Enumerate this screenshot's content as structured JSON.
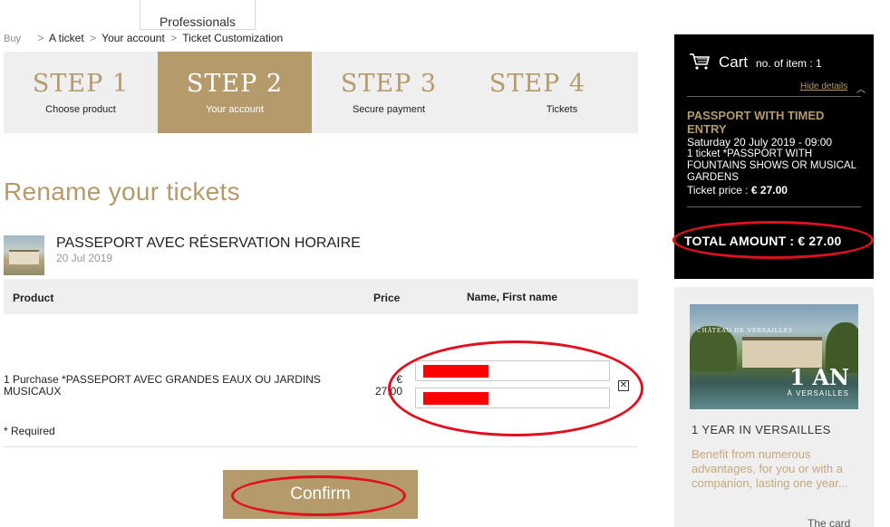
{
  "header": {
    "professionals_tab": "Professionals"
  },
  "breadcrumb": {
    "items": [
      "Buy",
      "A ticket",
      "Your account",
      "Ticket Customization"
    ],
    "separator": ">"
  },
  "steps": [
    {
      "num": "STEP 1",
      "label": "Choose product"
    },
    {
      "num": "STEP 2",
      "label": "Your account",
      "active": true
    },
    {
      "num": "STEP 3",
      "label": "Secure payment"
    },
    {
      "num": "STEP 4",
      "label": "Tickets"
    }
  ],
  "page_title": "Rename your tickets",
  "product": {
    "name": "PASSEPORT AVEC RÉSERVATION HORAIRE",
    "date": "20 Jul 2019"
  },
  "table": {
    "headers": {
      "product": "Product",
      "price": "Price",
      "name": "Name, First name"
    },
    "row": {
      "description": "1 Purchase *PASSEPORT AVEC GRANDES EAUX OU JARDINS MUSICAUX",
      "currency": "€",
      "price": "27.00"
    },
    "remove_icon": "close-box-icon"
  },
  "required_note": "* Required",
  "confirm_label": "Confirm",
  "cart": {
    "title": "Cart",
    "count_label": "no. of item : 1",
    "hide_details": "Hide details",
    "item_title": "PASSPORT WITH TIMED ENTRY",
    "item_date": "Saturday 20 July 2019 - 09:00",
    "item_desc": "1 ticket *PASSPORT WITH FOUNTAINS SHOWS OR MUSICAL GARDENS",
    "item_price_label": "Ticket price : ",
    "item_price": "€ 27.00",
    "total": "TOTAL AMOUNT : € 27.00"
  },
  "promo": {
    "image_logo": "CHÂTEAU DE VERSAILLES",
    "badge_big": "1 AN",
    "badge_small": "À VERSAILLES",
    "title": "1 YEAR IN VERSAILLES",
    "text": "Benefit from numerous advantages, for you or with a companion, lasting one year...",
    "more": "The card"
  },
  "colors": {
    "gold": "#b59a6b",
    "highlight_red": "#e01020",
    "redaction": "#ff0000",
    "cart_bg": "#000000"
  }
}
